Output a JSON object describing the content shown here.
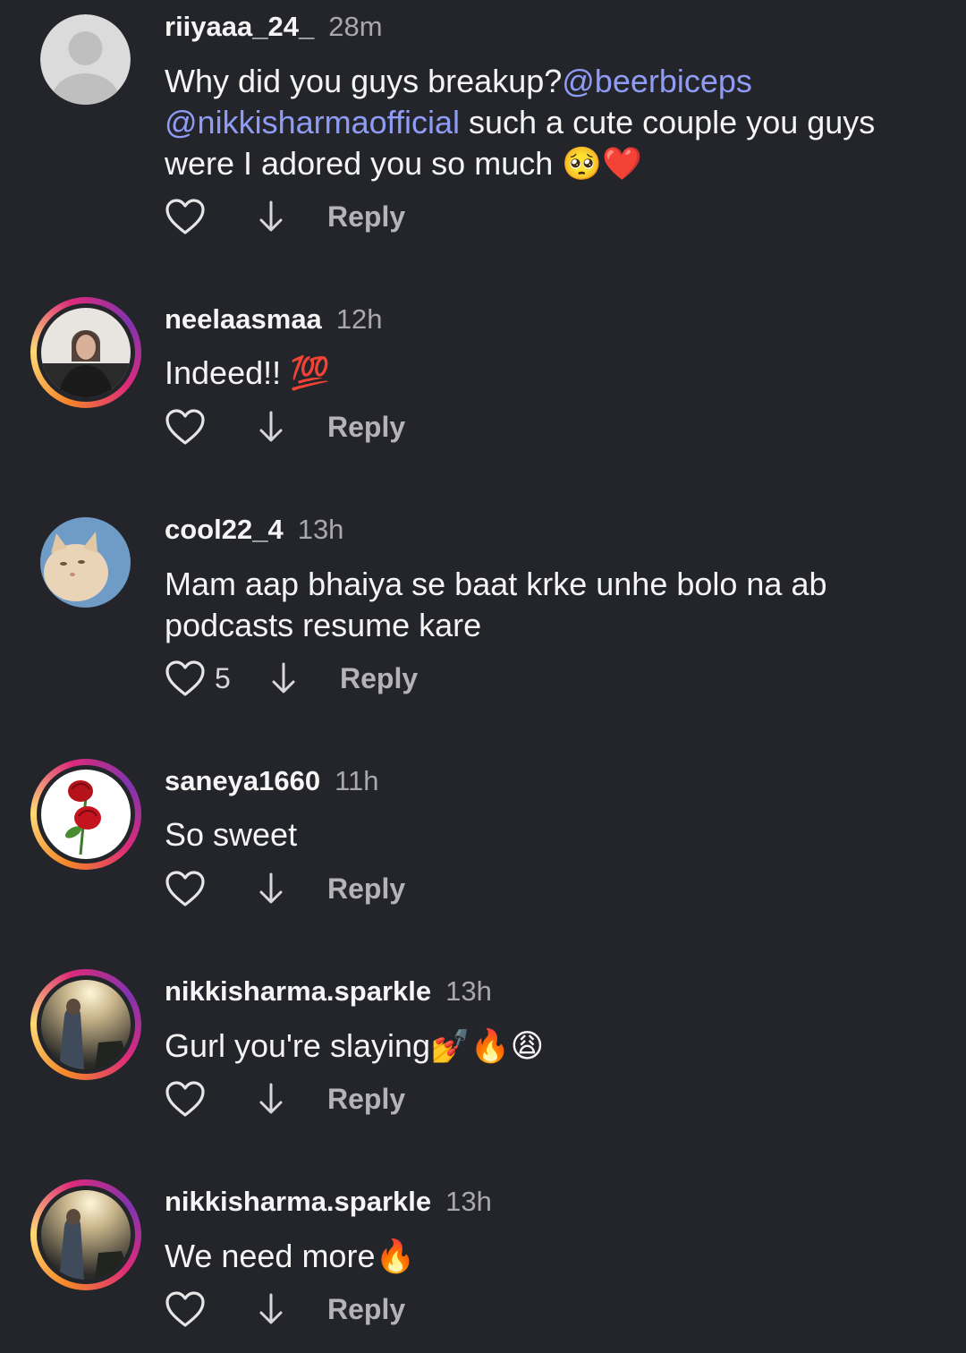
{
  "comments": [
    {
      "username": "riiyaaa_24_",
      "time": "28m",
      "text_before": "Why did you guys breakup?",
      "mention1": "@beerbiceps",
      "mention2": "@nikkisharmaofficial",
      "text_after": " such a cute couple you guys were I adored you so much 🥺❤️",
      "likes": "",
      "reply_label": "Reply"
    },
    {
      "username": "neelaasmaa",
      "time": "12h",
      "text": "Indeed!! 💯",
      "likes": "",
      "reply_label": "Reply"
    },
    {
      "username": "cool22_4",
      "time": "13h",
      "text": "Mam aap bhaiya se baat krke unhe bolo na ab podcasts resume kare",
      "likes": "5",
      "reply_label": "Reply"
    },
    {
      "username": "saneya1660",
      "time": "11h",
      "text": "So sweet",
      "likes": "",
      "reply_label": "Reply"
    },
    {
      "username": "nikkisharma.sparkle",
      "time": "13h",
      "text": "Gurl you're slaying💅🔥😩",
      "likes": "",
      "reply_label": "Reply"
    },
    {
      "username": "nikkisharma.sparkle",
      "time": "13h",
      "text": "We need more🔥",
      "likes": "",
      "reply_label": "Reply"
    }
  ],
  "icons": {
    "like": "heart-outline-icon",
    "dislike": "arrow-down-icon"
  },
  "colors": {
    "background": "#24252a",
    "mention": "#8f9cf5",
    "secondary_text": "#a8a8ad"
  }
}
